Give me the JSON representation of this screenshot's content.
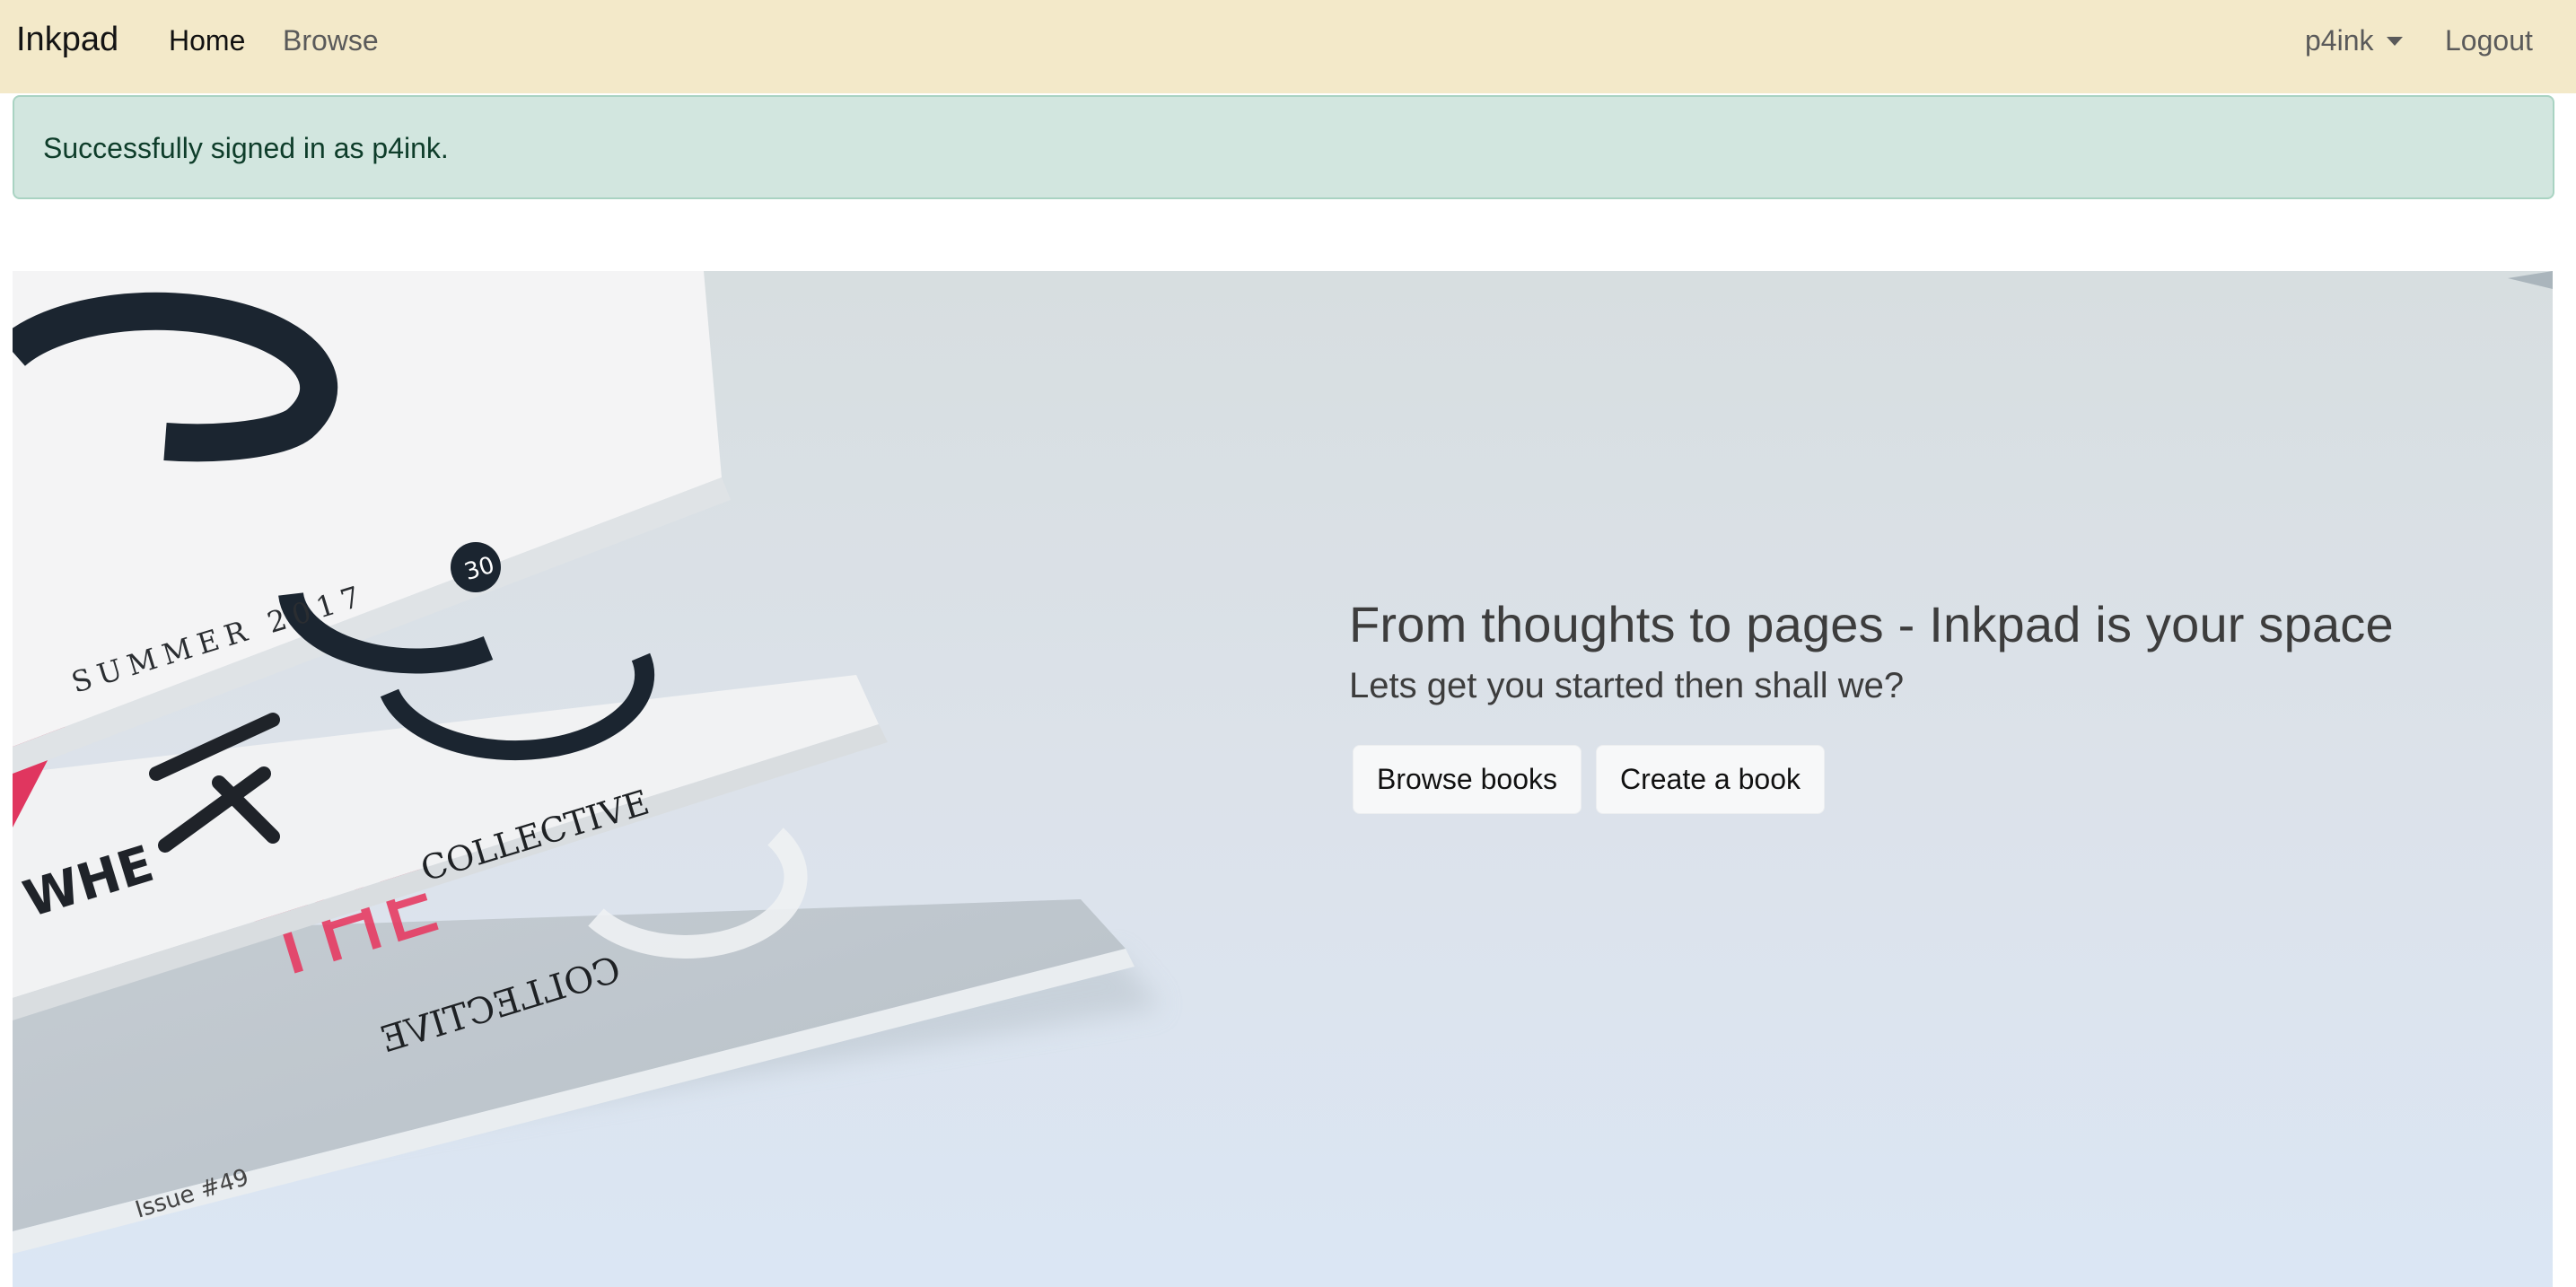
{
  "navbar": {
    "brand": "Inkpad",
    "links": {
      "home": "Home",
      "browse": "Browse"
    },
    "user_menu": "p4ink",
    "logout": "Logout"
  },
  "alert": {
    "message": "Successfully signed in as p4ink."
  },
  "hero": {
    "title": "From thoughts to pages - Inkpad is your space",
    "subtitle": "Lets get you started then shall we?",
    "buttons": {
      "browse_books": "Browse books",
      "create_book": "Create a book"
    },
    "image": {
      "subject": "stack-of-magazines",
      "magazine_texts": {
        "season": "SUMMER 2017",
        "badge": "30",
        "masthead": "COLLECTIVE",
        "headline": "THE",
        "issue": "Issue #49"
      }
    }
  },
  "colors": {
    "navbar_bg": "#f3e9c9",
    "alert_bg": "#d2e6df",
    "alert_border": "#a9d3c2",
    "alert_text": "#0e3d2a",
    "hero_text": "#3d3d3d",
    "button_bg": "#f7f8f9"
  }
}
